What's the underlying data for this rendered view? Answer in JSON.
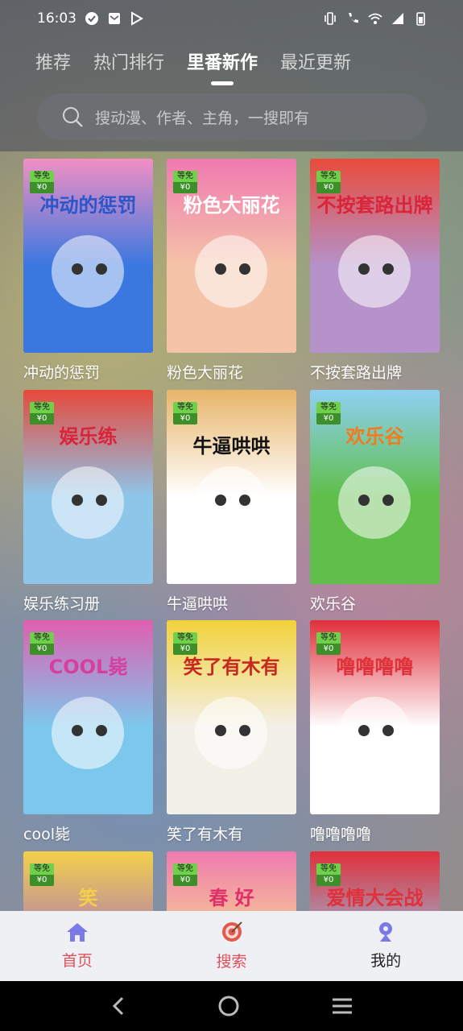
{
  "status_bar": {
    "time": "16:03"
  },
  "tabs": [
    {
      "label": "推荐",
      "active": false
    },
    {
      "label": "热门排行",
      "active": false
    },
    {
      "label": "里番新作",
      "active": true
    },
    {
      "label": "最近更新",
      "active": false
    }
  ],
  "search": {
    "placeholder": "搜动漫、作者、主角，一搜即有"
  },
  "badge": {
    "line1": "等免",
    "line2": "¥0"
  },
  "comics": [
    {
      "title": "冲动的惩罚",
      "cover_text": "冲动的惩罚",
      "bg": "#3a78e0",
      "accent": "#f28fc4",
      "text_color": "#2b55c8"
    },
    {
      "title": "粉色大丽花",
      "cover_text": "粉色大丽花",
      "bg": "#f4c3a8",
      "accent": "#f07ab0",
      "text_color": "#ffffff"
    },
    {
      "title": "不按套路出牌",
      "cover_text": "不按套路出牌",
      "bg": "#b592c9",
      "accent": "#e84b3c",
      "text_color": "#d9243a"
    },
    {
      "title": "娱乐练习册",
      "cover_text": "娱乐练",
      "bg": "#8ec6ea",
      "accent": "#e6493b",
      "text_color": "#d9243a"
    },
    {
      "title": "牛逼哄哄",
      "cover_text": "牛逼哄哄",
      "bg": "#ffffff",
      "accent": "#e8b56a",
      "text_color": "#111111"
    },
    {
      "title": "欢乐谷",
      "cover_text": "欢乐谷",
      "bg": "#5fbf4a",
      "accent": "#8fd0f4",
      "text_color": "#f47a1f"
    },
    {
      "title": "cool毙",
      "cover_text": "COOL毙",
      "bg": "#7cc8ec",
      "accent": "#e05fb0",
      "text_color": "#d5409e"
    },
    {
      "title": "笑了有木有",
      "cover_text": "笑了有木有",
      "bg": "#f3f0e8",
      "accent": "#f2d23a",
      "text_color": "#c8281f"
    },
    {
      "title": "噜噜噜噜",
      "cover_text": "噜噜噜噜",
      "bg": "#ffffff",
      "accent": "#e0303a",
      "text_color": "#e0303a"
    },
    {
      "title": "",
      "cover_text": "笑",
      "bg": "#a36fc4",
      "accent": "#f4d04a",
      "text_color": "#f4d04a"
    },
    {
      "title": "",
      "cover_text": "春 好",
      "bg": "#f7e08a",
      "accent": "#f07ab0",
      "text_color": "#e0306a"
    },
    {
      "title": "",
      "cover_text": "爱情大会战",
      "bg": "#8ec6ea",
      "accent": "#e0303a",
      "text_color": "#e0303a"
    }
  ],
  "bottom_nav": [
    {
      "label": "首页",
      "icon": "home-icon",
      "color": "#e0505a"
    },
    {
      "label": "搜索",
      "icon": "target-icon",
      "color": "#e0505a"
    },
    {
      "label": "我的",
      "icon": "user-icon",
      "color": "#222222"
    }
  ],
  "colors": {
    "nav_icon": "#7b78e8",
    "target_icon": "#e25a4d"
  }
}
